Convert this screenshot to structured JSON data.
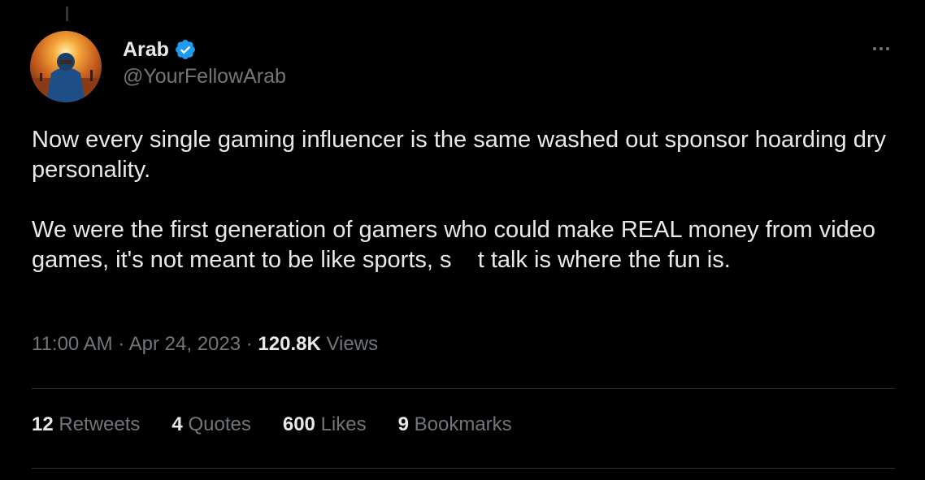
{
  "author": {
    "display_name": "Arab",
    "handle": "@YourFellowArab",
    "verified": true,
    "avatar_icon": "profile-avatar"
  },
  "tweet": {
    "paragraph_1": "Now every single gaming influencer is the same washed out sponsor hoarding dry personality.",
    "paragraph_2": "We were the first generation of gamers who could make REAL money from video games, it's not meant to be like sports, s    t talk is where the fun is."
  },
  "meta": {
    "time": "11:00 AM",
    "separator": "·",
    "date": "Apr 24, 2023",
    "views_count": "120.8K",
    "views_label": "Views"
  },
  "stats": [
    {
      "count": "12",
      "label": "Retweets"
    },
    {
      "count": "4",
      "label": "Quotes"
    },
    {
      "count": "600",
      "label": "Likes"
    },
    {
      "count": "9",
      "label": "Bookmarks"
    }
  ],
  "colors": {
    "background": "#000000",
    "primary_text": "#e7e9ea",
    "secondary_text": "#71767b",
    "verified_blue": "#1d9bf0",
    "divider": "#2f3336"
  }
}
